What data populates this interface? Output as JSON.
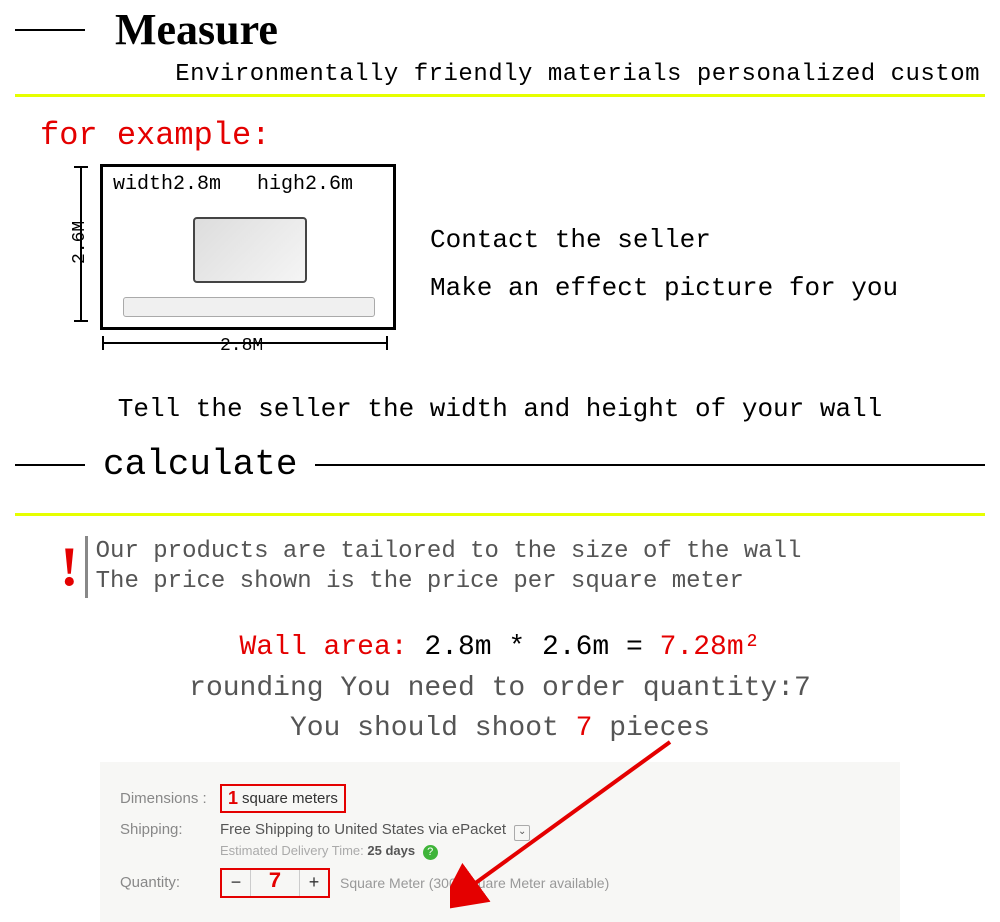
{
  "header": {
    "title": "Measure",
    "subtitle": "Environmentally friendly materials personalized custom"
  },
  "example": {
    "label": "for example:",
    "wall_text_width": "width2.8m",
    "wall_text_high": "high2.6m",
    "dim_v": "2.6M",
    "dim_h": "2.8M",
    "contact": "Contact the seller",
    "effect": "Make an effect picture for you",
    "tell": "Tell the seller the width and height of your wall"
  },
  "calculate": {
    "title": "calculate",
    "notice_line1": "Our products are tailored to the size of the wall",
    "notice_line2": "The price shown is the price per square meter",
    "area_label": "Wall area:",
    "area_formula": "2.8m * 2.6m =",
    "area_result": "7.28m²",
    "rounding_line": "rounding  You need to order quantity:7",
    "shoot_a": "You should shoot ",
    "shoot_qty": "7",
    "shoot_b": " pieces"
  },
  "form": {
    "dimensions_label": "Dimensions :",
    "dimensions_qty": "1",
    "dimensions_unit": "square meters",
    "shipping_label": "Shipping:",
    "shipping_text": "Free Shipping to United States via ePacket",
    "estimated_a": "Estimated Delivery Time: ",
    "estimated_days": "25 days",
    "quantity_label": "Quantity:",
    "quantity_value": "7",
    "available": "Square Meter (300 Square Meter available)",
    "minus": "−",
    "plus": "+"
  }
}
